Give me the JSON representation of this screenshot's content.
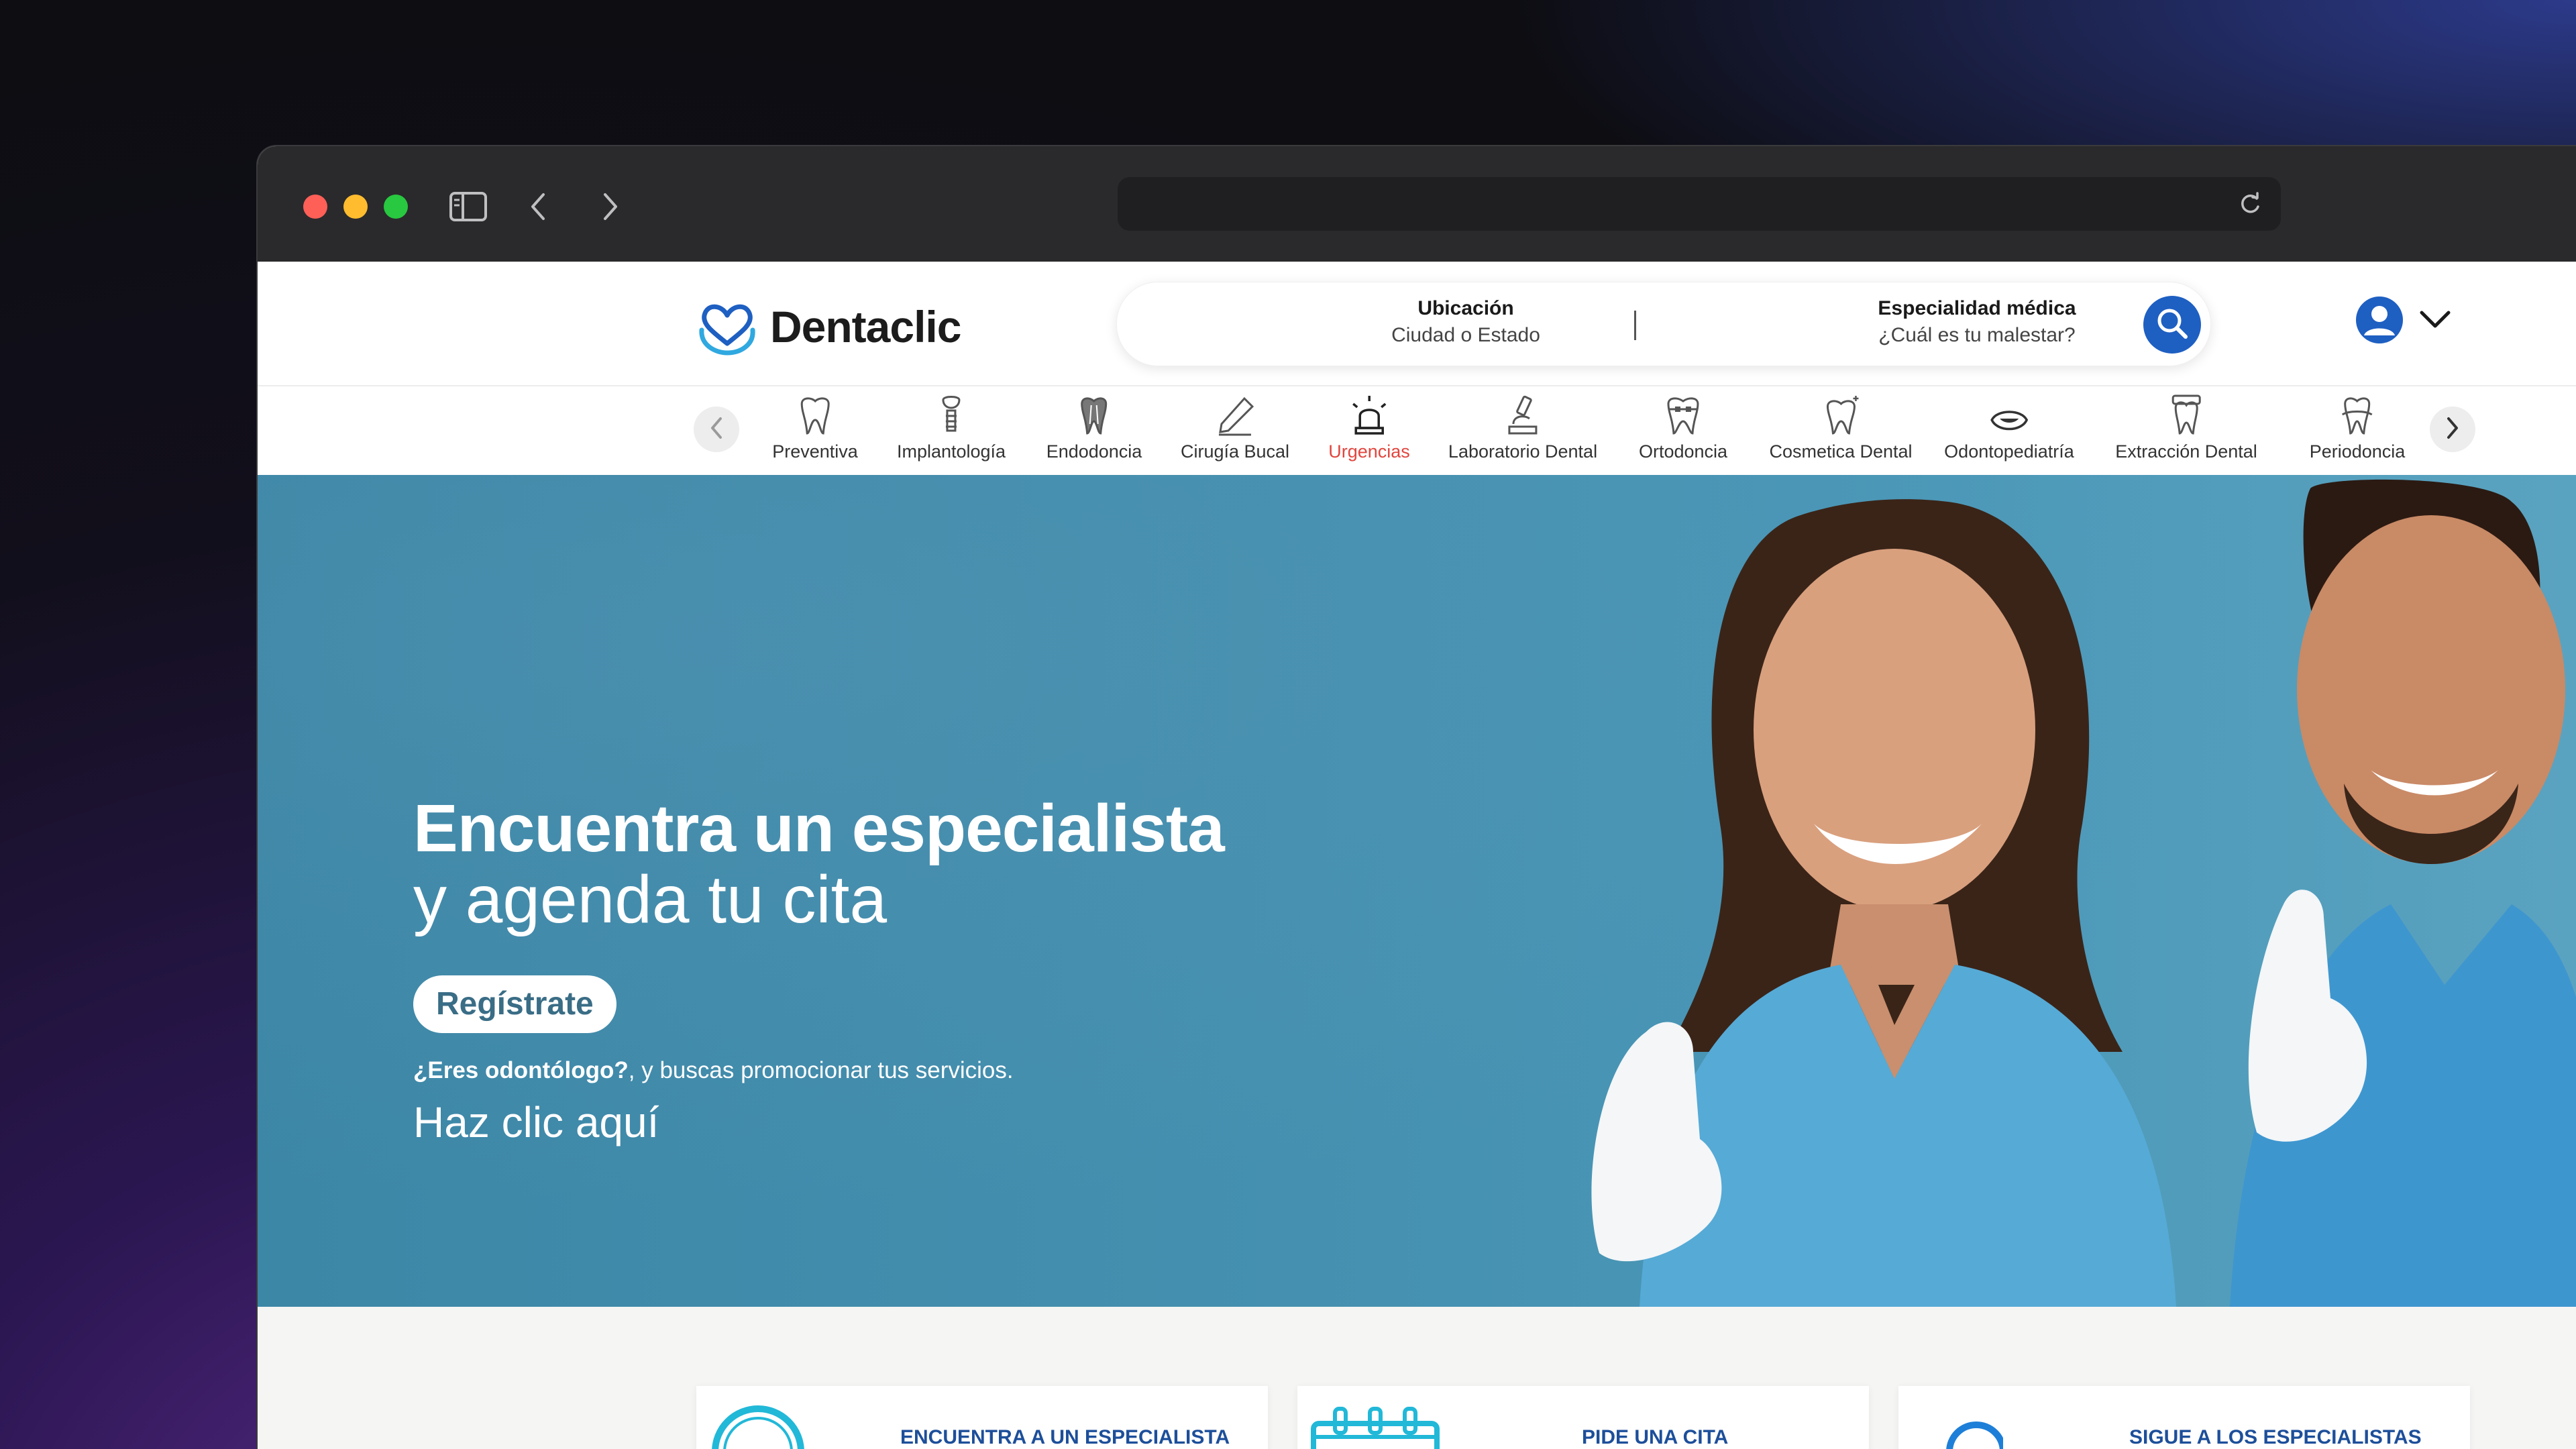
{
  "brand": {
    "name": "Dentaclic",
    "primary": "#1e5fc2",
    "accent_active": "#e0463e",
    "hero_bg": "#4590b0",
    "card_title": "#1d4f9a"
  },
  "browser": {
    "traffic_lights": [
      "#fe5f57",
      "#febc2e",
      "#28c840"
    ],
    "url": ""
  },
  "search": {
    "location_label": "Ubicación",
    "location_placeholder": "Ciudad o Estado",
    "specialty_label": "Especialidad médica",
    "specialty_placeholder": "¿Cuál es tu malestar?"
  },
  "categories": [
    {
      "label": "Preventiva",
      "icon": "tooth-icon"
    },
    {
      "label": "Implantología",
      "icon": "implant-icon"
    },
    {
      "label": "Endodoncia",
      "icon": "root-canal-icon"
    },
    {
      "label": "Cirugía Bucal",
      "icon": "scalpel-icon"
    },
    {
      "label": "Urgencias",
      "icon": "alarm-light-icon",
      "active": true
    },
    {
      "label": "Laboratorio Dental",
      "icon": "microscope-icon"
    },
    {
      "label": "Ortodoncia",
      "icon": "braces-icon"
    },
    {
      "label": "Cosmetica Dental",
      "icon": "sparkle-tooth-icon"
    },
    {
      "label": "Odontopediatría",
      "icon": "kid-smile-icon"
    },
    {
      "label": "Extracción Dental",
      "icon": "extraction-icon"
    },
    {
      "label": "Periodoncia",
      "icon": "gum-tooth-icon"
    }
  ],
  "hero": {
    "title_line1": "Encuentra un especialista",
    "title_line2": "y agenda tu cita",
    "register_button": "Regístrate",
    "note_bold": "¿Eres odontólogo?",
    "note_rest": ", y buscas promocionar tus servicios.",
    "cta_link": "Haz clic aquí"
  },
  "features": [
    {
      "title": "ENCUENTRA A UN ESPECIALISTA",
      "icon": "search-ring-icon"
    },
    {
      "title": "PIDE UNA CITA",
      "icon": "calendar-icon"
    },
    {
      "title": "SIGUE A LOS ESPECIALISTAS",
      "icon": "follow-user-icon"
    }
  ]
}
